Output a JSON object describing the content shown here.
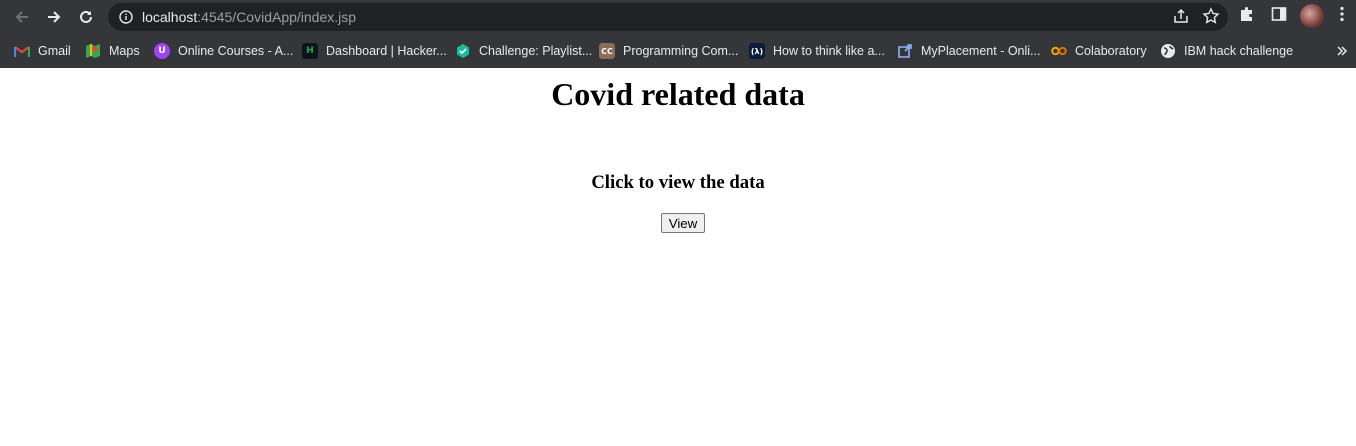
{
  "browser": {
    "url_host": "localhost",
    "url_path": ":4545/CovidApp/index.jsp",
    "bookmarks": [
      {
        "label": "Gmail",
        "icon": "gmail-icon",
        "color": "#ea4335"
      },
      {
        "label": "Maps",
        "icon": "maps-icon",
        "color": "#34a853"
      },
      {
        "label": "Online Courses - A...",
        "icon": "online-courses-icon",
        "color": "#a142f4"
      },
      {
        "label": "Dashboard | Hacker...",
        "icon": "hackerrank-icon",
        "color": "#1ba94c"
      },
      {
        "label": "Challenge: Playlist...",
        "icon": "challenge-icon",
        "color": "#1bbc9b"
      },
      {
        "label": "Programming Com...",
        "icon": "codechef-icon",
        "color": "#8a6d55"
      },
      {
        "label": "How to think like a...",
        "icon": "lambda-icon",
        "color": "#0d1c3b"
      },
      {
        "label": "MyPlacement - Onli...",
        "icon": "external-link-icon",
        "color": "#8ab4f8"
      },
      {
        "label": "Colaboratory",
        "icon": "colab-icon",
        "color": "#f9ab00"
      },
      {
        "label": "IBM hack challenge",
        "icon": "globe-icon",
        "color": "#e8eaed"
      }
    ],
    "icon_codes": {
      "codechef": "CC",
      "lambda": "(λ)",
      "hackerrank": "H"
    }
  },
  "page": {
    "title": "Covid related data",
    "subtitle": "Click to view the data",
    "button_label": "View"
  }
}
